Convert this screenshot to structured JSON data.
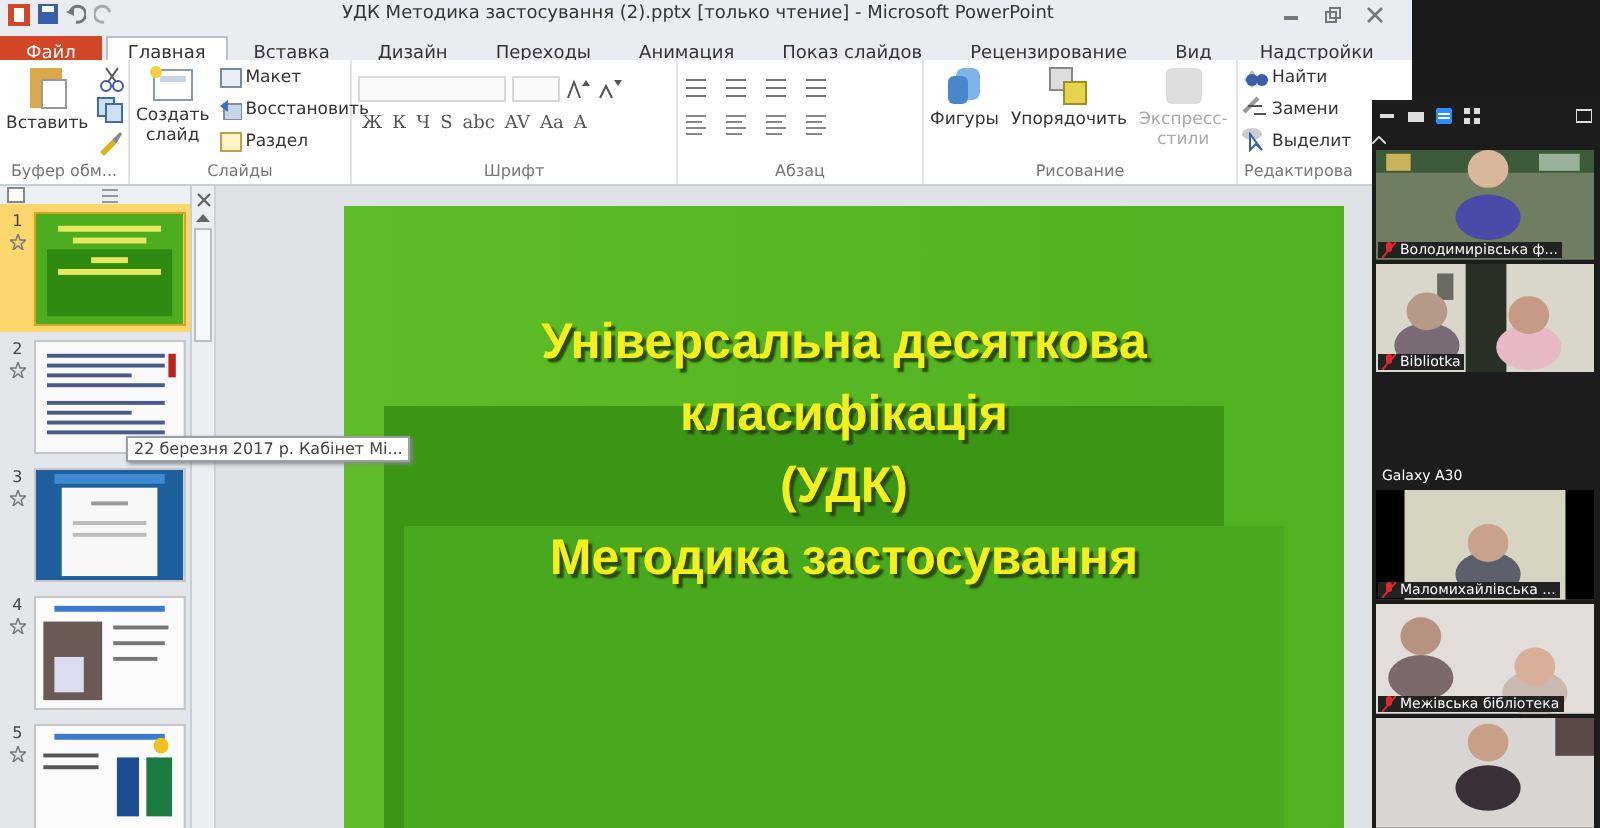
{
  "window": {
    "title": "УДК Методика застосування (2).pptx [только чтение] - Microsoft PowerPoint"
  },
  "tabs": [
    {
      "label": "Файл",
      "kind": "file",
      "selected": false
    },
    {
      "label": "Главная",
      "kind": "tab",
      "selected": true
    },
    {
      "label": "Вставка",
      "kind": "tab",
      "selected": false
    },
    {
      "label": "Дизайн",
      "kind": "tab",
      "selected": false
    },
    {
      "label": "Переходы",
      "kind": "tab",
      "selected": false
    },
    {
      "label": "Анимация",
      "kind": "tab",
      "selected": false
    },
    {
      "label": "Показ слайдов",
      "kind": "tab",
      "selected": false
    },
    {
      "label": "Рецензирование",
      "kind": "tab",
      "selected": false
    },
    {
      "label": "Вид",
      "kind": "tab",
      "selected": false
    },
    {
      "label": "Надстройки",
      "kind": "tab",
      "selected": false
    }
  ],
  "ribbon": {
    "clipboard": {
      "paste": "Вставить",
      "label": "Буфер обм..."
    },
    "slides": {
      "new_slide": [
        "Создать",
        "слайд"
      ],
      "layout": "Макет",
      "reset": "Восстановить",
      "section": "Раздел",
      "label": "Слайды"
    },
    "font": {
      "format_buttons": [
        "Ж",
        "К",
        "Ч",
        "S",
        "abc",
        "AV",
        "Aa",
        "A"
      ],
      "label": "Шрифт"
    },
    "paragraph": {
      "label": "Абзац"
    },
    "drawing": {
      "shapes": "Фигуры",
      "arrange": "Упорядочить",
      "quick_styles": {
        "label": "Экспресс-стили",
        "disabled": true
      },
      "label": "Рисование"
    },
    "editing": {
      "find": "Найти",
      "replace": "Замени",
      "select": "Выделит",
      "label": "Редактирова"
    }
  },
  "slides_pane": {
    "thumbnails": [
      {
        "number": "1",
        "kind": "title",
        "selected": true
      },
      {
        "number": "2",
        "kind": "text",
        "selected": false
      },
      {
        "number": "3",
        "kind": "document",
        "selected": false
      },
      {
        "number": "4",
        "selected": false
      },
      {
        "number": "5",
        "kind": "books",
        "selected": false
      }
    ],
    "tooltip": "22 березня 2017 р. Кабінет Мі..."
  },
  "slide": {
    "title_lines": [
      "Універсальна десяткова",
      "класифікація",
      "(УДК)",
      "Методика застосування"
    ]
  },
  "video_panel": {
    "participants": [
      {
        "name": "Володимирівська ф...",
        "kind": "video",
        "muted": true
      },
      {
        "name": "Bibliotka",
        "kind": "video",
        "muted": true
      },
      {
        "name": "Galaxy A30",
        "kind": "no_video"
      },
      {
        "name": "Маломихайлівська ...",
        "kind": "video",
        "muted": true
      },
      {
        "name": "Межівська бібліотека",
        "kind": "video",
        "muted": true
      },
      {
        "kind": "video"
      }
    ]
  }
}
